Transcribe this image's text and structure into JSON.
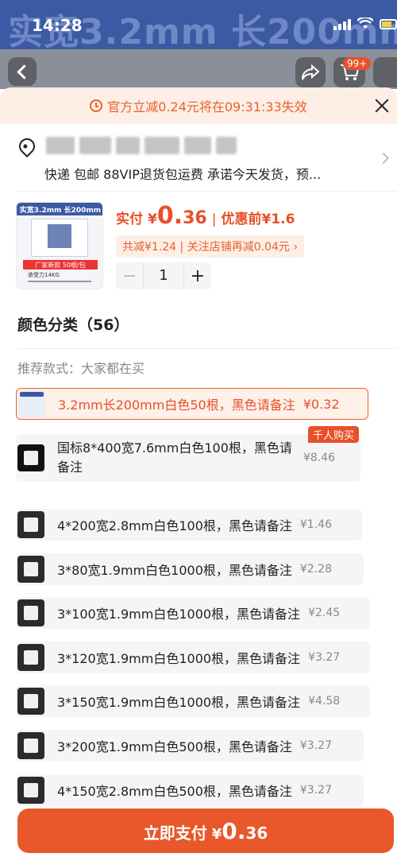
{
  "status_bar": {
    "time": "14:28"
  },
  "background": {
    "banner_text": "实宽3.2mm 长200mm",
    "cart_badge": "99+"
  },
  "promo": {
    "text": "官方立减0.24元将在09:31:33失效"
  },
  "address": {
    "delivery_line": "快递 包邮 88VIP退货包运费 承诺今天发货，预..."
  },
  "product": {
    "thumb_header": "实宽3.2mm 长200mm",
    "thumb_red_label": "厂家新款 50根/包",
    "thumb_sub_label": "承受力14KG",
    "price_label": "实付",
    "currency": "¥",
    "price_int": "0.",
    "price_dec": "36",
    "price_separator": "|",
    "coupon_text": "优惠前¥1.6",
    "discount_tag": "共减¥1.24 | 关注店铺再减0.04元 ›",
    "quantity": "1",
    "minus_label": "−",
    "plus_label": "+"
  },
  "sku": {
    "title": "颜色分类（56）",
    "recommend_title": "推荐款式：大家都在买",
    "hot_tag": "千人购买",
    "options": [
      {
        "name": "3.2mm长200mm白色50根，黑色请备注",
        "price": "¥0.32",
        "selected": true
      },
      {
        "name": "国标8*400宽7.6mm白色100根，黑色请备注",
        "price": "¥8.46",
        "selected": false
      },
      {
        "name": "4*200宽2.8mm白色100根，黑色请备注",
        "price": "¥1.46",
        "selected": false
      },
      {
        "name": "3*80宽1.9mm白色1000根，黑色请备注",
        "price": "¥2.28",
        "selected": false
      },
      {
        "name": "3*100宽1.9mm白色1000根，黑色请备注",
        "price": "¥2.45",
        "selected": false
      },
      {
        "name": "3*120宽1.9mm白色1000根，黑色请备注",
        "price": "¥3.27",
        "selected": false
      },
      {
        "name": "3*150宽1.9mm白色1000根，黑色请备注",
        "price": "¥4.58",
        "selected": false
      },
      {
        "name": "3*200宽1.9mm白色500根，黑色请备注",
        "price": "¥3.27",
        "selected": false
      },
      {
        "name": "4*150宽2.8mm白色500根，黑色请备注",
        "price": "¥3.27",
        "selected": false
      }
    ]
  },
  "pay_button": {
    "label": "立即支付",
    "currency": "¥",
    "price_int": "0.",
    "price_dec": "36"
  },
  "colors": {
    "accent": "#e8582a",
    "promo_bg": "#fdeee6",
    "brand_blue": "#3b5aa3"
  }
}
